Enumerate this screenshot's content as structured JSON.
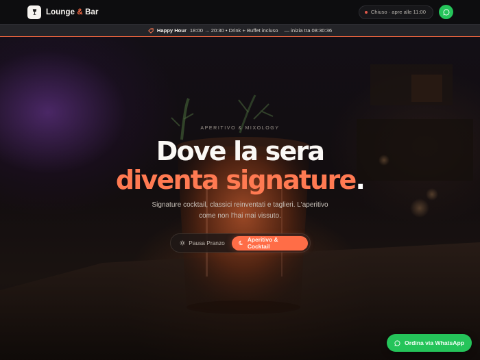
{
  "header": {
    "brand": {
      "name_part1": "Lounge ",
      "amp": "&",
      "name_part2": " Bar"
    },
    "status": {
      "text": "Chiuso · apre alle 11:00",
      "dot_color": "#e0594b"
    },
    "whatsapp_icon": "whatsapp-icon"
  },
  "promo": {
    "icon": "tag-icon",
    "title": "Happy Hour",
    "details": "18:00 → 20:30 • Drink + Buffet incluso",
    "countdown": "— inizia tra 08:30:36"
  },
  "hero": {
    "eyebrow": "APERITIVO & MIXOLOGY",
    "headline_line1": "Dove la sera",
    "headline_line2": "diventa signature",
    "headline_dot": ".",
    "subtext": "Signature cocktail, classici reinventati e taglieri. L'aperitivo come non l'hai mai vissuto.",
    "toggle": [
      {
        "label": "Pausa Pranzo",
        "icon": "sun-icon",
        "active": false
      },
      {
        "label": "Aperitivo & Cocktail",
        "icon": "moon-icon",
        "active": true
      }
    ]
  },
  "cta": {
    "label": "Ordina via WhatsApp",
    "icon": "whatsapp-icon"
  },
  "colors": {
    "accent": "#ff6d47",
    "whatsapp": "#25c45a",
    "background": "#0d0d0f"
  }
}
